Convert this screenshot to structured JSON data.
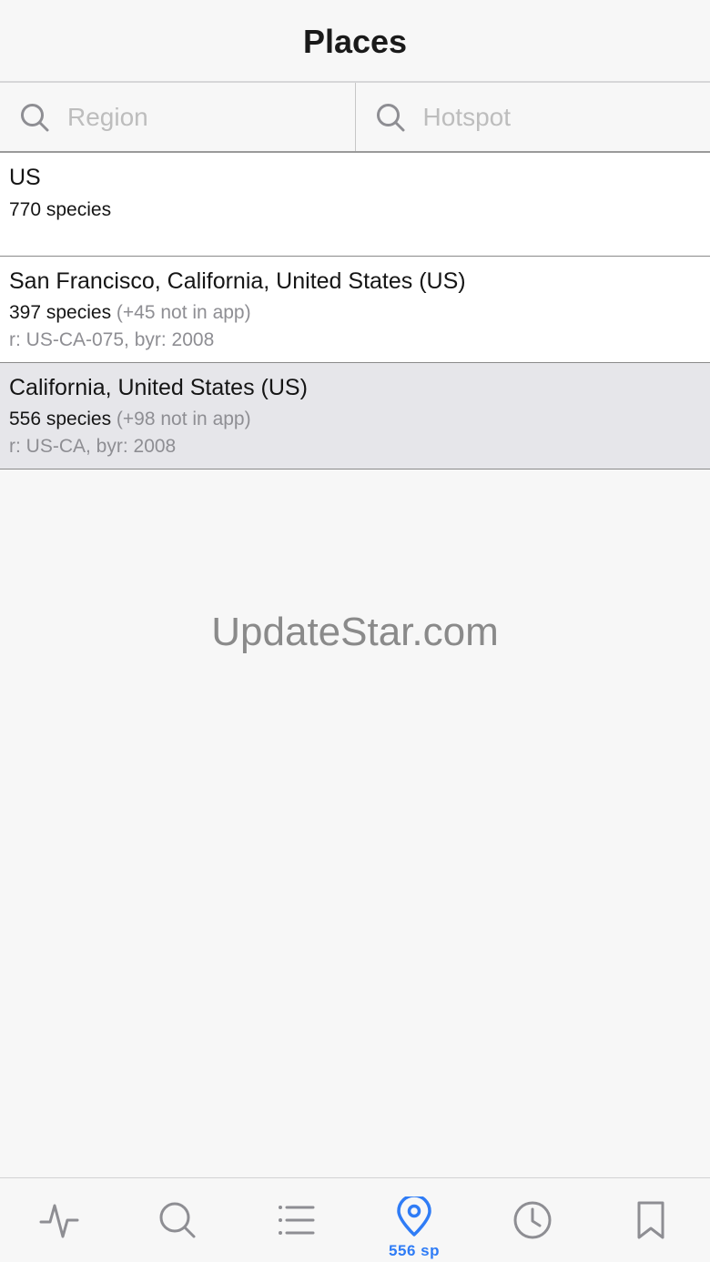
{
  "header": {
    "title": "Places"
  },
  "search": {
    "region_placeholder": "Region",
    "hotspot_placeholder": "Hotspot",
    "region_value": "",
    "hotspot_value": ""
  },
  "list": {
    "region": {
      "title": "US",
      "species": "770 species"
    },
    "places": [
      {
        "title": "San Francisco, California, United States (US)",
        "species": "397 species",
        "extra": " (+45 not in app)",
        "meta": "r: US-CA-075, byr: 2008",
        "selected": false
      },
      {
        "title": "California, United States (US)",
        "species": "556 species",
        "extra": " (+98 not in app)",
        "meta": "r: US-CA, byr: 2008",
        "selected": true
      }
    ]
  },
  "watermark": "UpdateStar.com",
  "tabbar": {
    "active_index": 3,
    "tabs": [
      {
        "icon": "activity-icon",
        "label": ""
      },
      {
        "icon": "search-icon",
        "label": ""
      },
      {
        "icon": "list-icon",
        "label": ""
      },
      {
        "icon": "location-pin-icon",
        "label": "556 sp"
      },
      {
        "icon": "clock-icon",
        "label": ""
      },
      {
        "icon": "bookmark-icon",
        "label": ""
      }
    ]
  },
  "colors": {
    "accent": "#2f7cf6",
    "inactive_icon": "#8e8e93",
    "selected_row": "#e6e6ea",
    "background": "#f7f7f7"
  }
}
